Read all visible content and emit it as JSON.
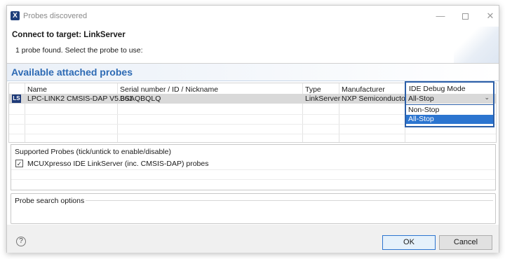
{
  "window": {
    "title": "Probes discovered",
    "app_icon": "X",
    "minimize": "—",
    "close": "✕"
  },
  "header": {
    "title": "Connect to target: LinkServer",
    "message": "1 probe found. Select the probe to use:"
  },
  "probes": {
    "heading": "Available attached probes",
    "columns": [
      "Name",
      "Serial number / ID / Nickname",
      "Type",
      "Manufacturer",
      "IDE Debug Mode"
    ],
    "rows": [
      {
        "icon": "LS",
        "name": "LPC-LINK2 CMSIS-DAP V5.361",
        "serial": "BSAQBQLQ",
        "type": "LinkServer",
        "manufacturer": "NXP Semiconductors",
        "debug_mode": "All-Stop"
      }
    ],
    "debug_mode_options": [
      "Non-Stop",
      "All-Stop"
    ],
    "debug_mode_selected": "All-Stop"
  },
  "supported": {
    "title": "Supported Probes (tick/untick to enable/disable)",
    "items": [
      {
        "label": "MCUXpresso IDE LinkServer (inc. CMSIS-DAP) probes",
        "checked": true
      }
    ]
  },
  "search_options": {
    "title": "Probe search options"
  },
  "footer": {
    "help": "?",
    "ok_label": "OK",
    "cancel_label": "Cancel"
  },
  "colors": {
    "heading_blue": "#2d6ab4",
    "selection_blue": "#2c75d0",
    "selected_row_gray": "#d9d9d9"
  }
}
